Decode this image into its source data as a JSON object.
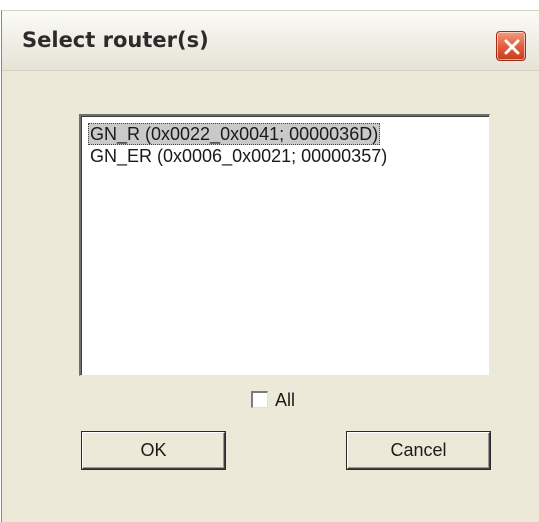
{
  "dialog": {
    "title": "Select router(s)",
    "close_icon": "close-icon",
    "accent_close": "#e2593a"
  },
  "router_list": {
    "items": [
      {
        "label": "GN_R (0x0022_0x0041; 0000036D)",
        "selected": true
      },
      {
        "label": "GN_ER (0x0006_0x0021; 00000357)",
        "selected": false
      }
    ]
  },
  "all_checkbox": {
    "label": "All",
    "checked": false
  },
  "buttons": {
    "ok_label": "OK",
    "cancel_label": "Cancel"
  }
}
